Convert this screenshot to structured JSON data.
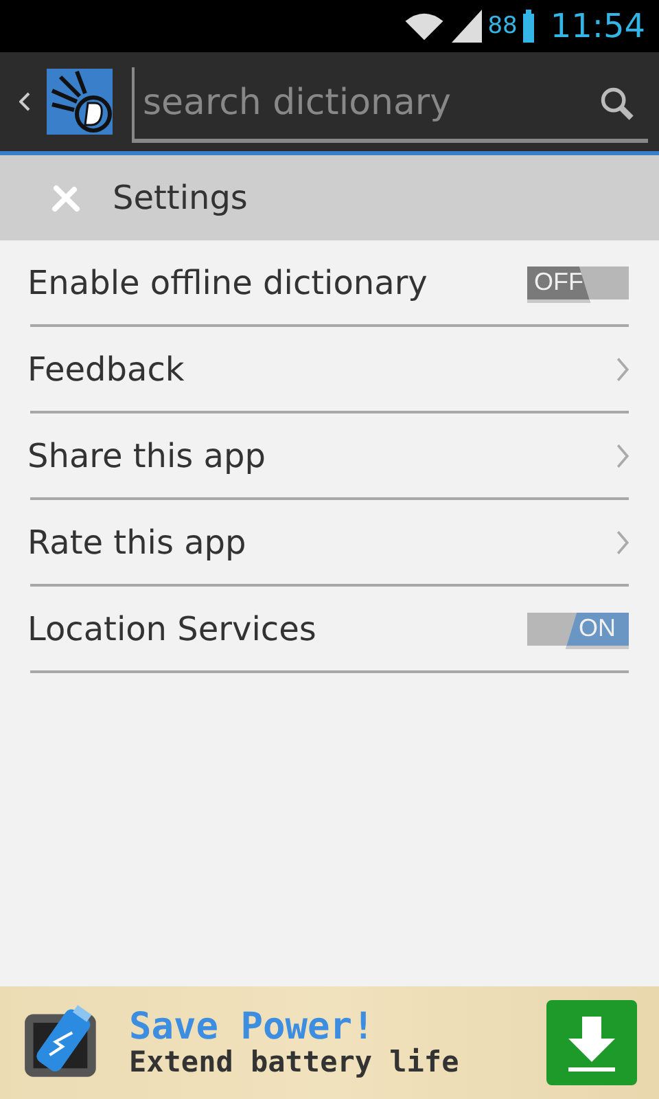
{
  "status_bar": {
    "battery_percent": "88",
    "time": "11:54"
  },
  "toolbar": {
    "search": {
      "placeholder": "search dictionary"
    }
  },
  "section": {
    "title": "Settings"
  },
  "settings": [
    {
      "kind": "toggle",
      "label": "Enable offline dictionary",
      "on": false,
      "state_text": "OFF"
    },
    {
      "kind": "link",
      "label": "Feedback"
    },
    {
      "kind": "link",
      "label": "Share this app"
    },
    {
      "kind": "link",
      "label": "Rate this app"
    },
    {
      "kind": "toggle",
      "label": "Location Services",
      "on": true,
      "state_text": "ON"
    }
  ],
  "ad": {
    "headline": "Save Power!",
    "tagline": "Extend battery life"
  }
}
